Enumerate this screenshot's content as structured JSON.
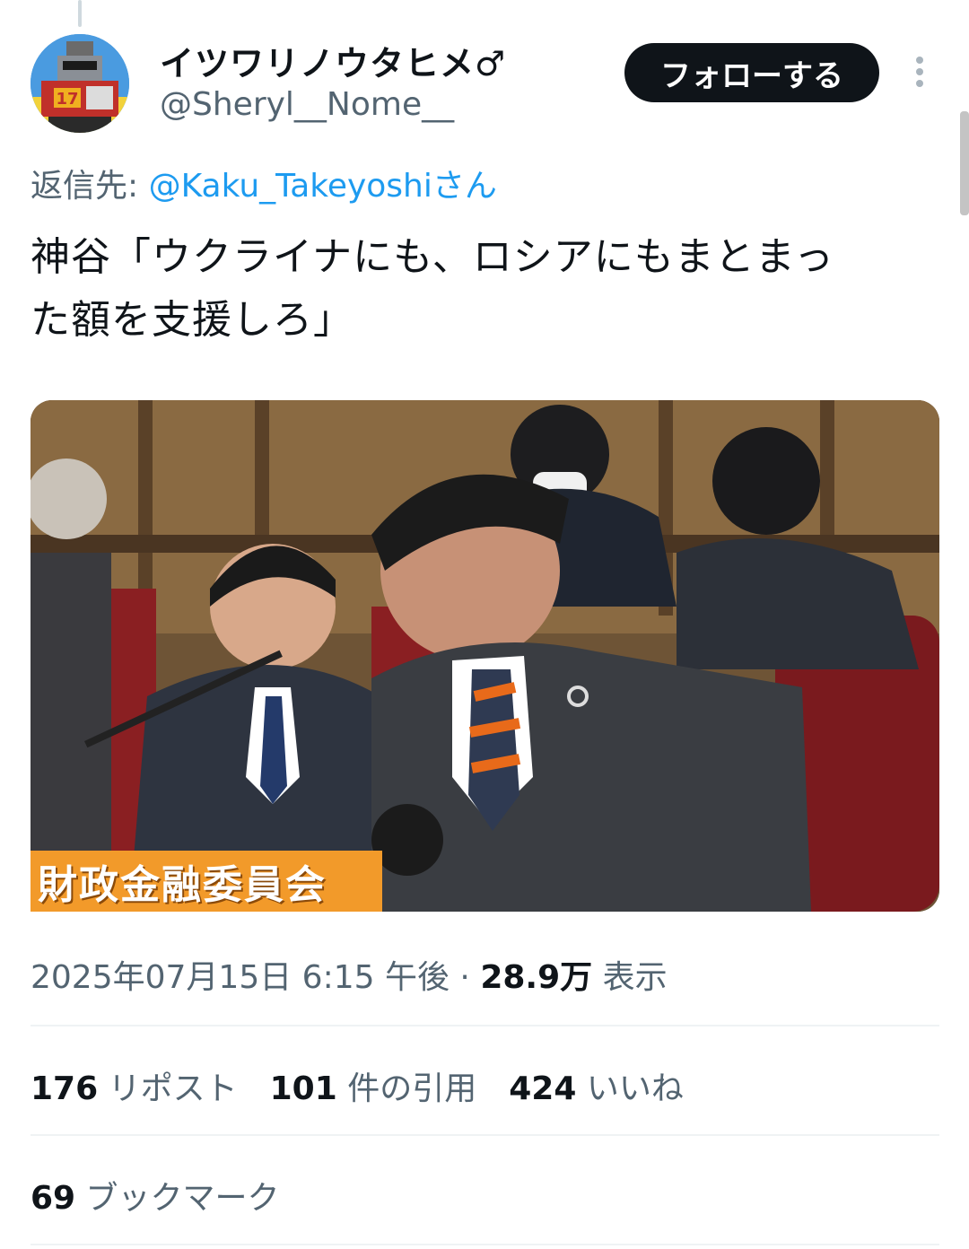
{
  "tweet": {
    "author": {
      "display_name": "イツワリノウタヒメ♂",
      "handle": "@Sheryl__Nome__",
      "avatar_badge": "17"
    },
    "follow_label": "フォローする",
    "reply_prefix": "返信先: ",
    "reply_mention": "@Kaku_Takeyoshi",
    "reply_suffix": "さん",
    "text_line1": "神谷「ウクライナにも、ロシアにもまとまっ",
    "text_line2": "た額を支援しろ」",
    "media": {
      "caption": "財政金融委員会",
      "muted_icon": "speaker-muted-icon"
    },
    "timestamp": "2025年07月15日 6:15 午後",
    "separator": " · ",
    "views_count": "28.9万",
    "views_label": " 表示",
    "stats": {
      "reposts": {
        "count": "176",
        "label": " リポスト"
      },
      "quotes": {
        "count": "101",
        "label": " 件の引用"
      },
      "likes": {
        "count": "424",
        "label": " いいね"
      },
      "bookmarks": {
        "count": "69",
        "label": " ブックマーク"
      }
    }
  },
  "colors": {
    "text": "#0f1419",
    "secondary": "#536471",
    "link": "#1d9bf0",
    "follow_bg": "#0f1419",
    "caption_bg": "#f29a2a"
  }
}
